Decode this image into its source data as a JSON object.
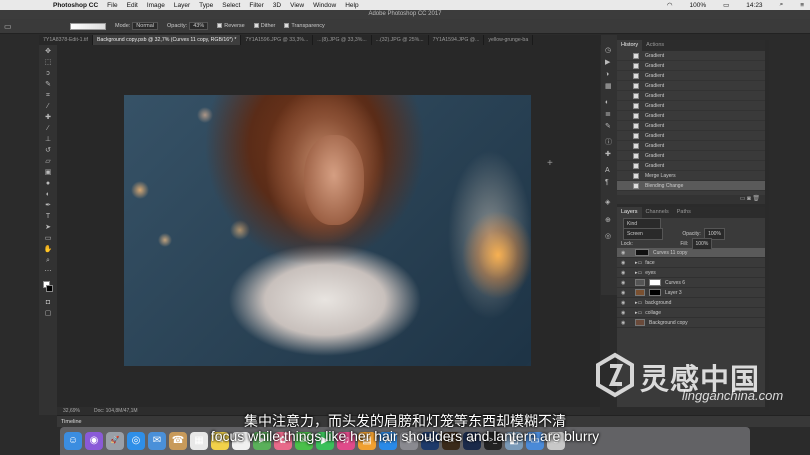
{
  "menubar": {
    "apple": "",
    "app": "Photoshop CC",
    "items": [
      "File",
      "Edit",
      "Image",
      "Layer",
      "Type",
      "Select",
      "Filter",
      "3D",
      "View",
      "Window",
      "Help"
    ],
    "battery": "100%",
    "time": "14:23"
  },
  "window_title": "Adobe Photoshop CC 2017",
  "options": {
    "mode_label": "Mode:",
    "mode_value": "Normal",
    "opacity_label": "Opacity:",
    "opacity_value": "43%",
    "reverse": "Reverse",
    "dither": "Dither",
    "transparency": "Transparency"
  },
  "tabs": [
    "7Y1A8378-Edit-1.tif",
    "Background copy.psb @ 32,7% (Curves 11 copy, RGB/16*) *",
    "7Y1A1596.JPG @ 33,3%...",
    "...(8).JPG @ 33,3%...",
    "...(32).JPG @ 25%...",
    "7Y1A1594.JPG @...",
    "yellow-grunge-ba"
  ],
  "status": {
    "zoom": "32,69%",
    "doc": "Doc: 104,8M/47,1M"
  },
  "timeline": "Timeline",
  "history": {
    "tabs": [
      "History",
      "Actions"
    ],
    "rows": [
      "Gradient",
      "Gradient",
      "Gradient",
      "Gradient",
      "Gradient",
      "Gradient",
      "Gradient",
      "Gradient",
      "Gradient",
      "Gradient",
      "Gradient",
      "Gradient",
      "Merge Layers",
      "Blending Change"
    ]
  },
  "layers": {
    "tabs": [
      "Layers",
      "Channels",
      "Paths"
    ],
    "kind": "Kind",
    "blend": "Screen",
    "opacity_label": "Opacity:",
    "opacity_value": "100%",
    "lock_label": "Lock:",
    "fill_label": "Fill:",
    "fill_value": "100%",
    "rows": [
      "Curves 11 copy",
      "face",
      "eyes",
      "Curves 6",
      "Layer 3",
      "background",
      "collage",
      "Background copy"
    ]
  },
  "subtitles": {
    "cn": "集中注意力，而头发的肩膀和灯笼等东西却模糊不清",
    "en": "focus while things like her hair shoulders and lantern are blurry"
  },
  "watermark": {
    "cn": "灵感中国",
    "en": "lingganchina.com"
  },
  "dock_icons": [
    "finder-icon",
    "siri-icon",
    "launchpad-icon",
    "safari-icon",
    "mail-icon",
    "contacts-icon",
    "calendar-icon",
    "notes-icon",
    "reminders-icon",
    "maps-icon",
    "photos-icon",
    "messages-icon",
    "facetime-icon",
    "itunes-icon",
    "ibooks-icon",
    "appstore-icon",
    "preferences-icon",
    "photoshop-icon",
    "bridge-icon",
    "lightroom-icon",
    "terminal-icon",
    "preview-icon",
    "folder-icon",
    "trash-icon"
  ]
}
